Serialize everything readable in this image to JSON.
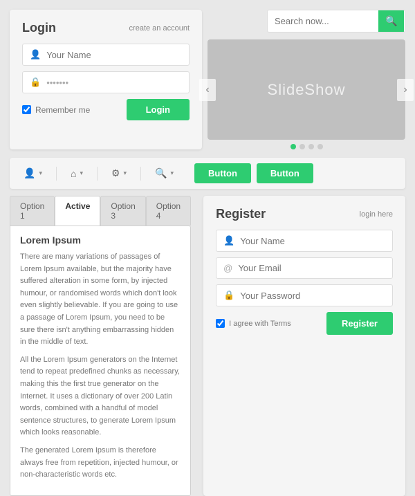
{
  "login": {
    "title": "Login",
    "create_link": "create an account",
    "name_placeholder": "Your Name",
    "password_placeholder": "●●●●●●●",
    "remember_label": "Remember me",
    "button_label": "Login"
  },
  "search": {
    "placeholder": "Search now...",
    "button_icon": "🔍"
  },
  "slideshow": {
    "label": "SlideShow",
    "dots": [
      true,
      false,
      false,
      false
    ],
    "arrow_left": "‹",
    "arrow_right": "›"
  },
  "navbar": {
    "items": [
      {
        "icon": "👤",
        "arrow": "▾"
      },
      {
        "icon": "🏠",
        "arrow": "▾"
      },
      {
        "icon": "⚙",
        "arrow": "▾"
      },
      {
        "icon": "🔍",
        "arrow": "▾"
      }
    ],
    "button1": "Button",
    "button2": "Button"
  },
  "tabs": {
    "items": [
      {
        "label": "Option 1",
        "active": false
      },
      {
        "label": "Active",
        "active": true
      },
      {
        "label": "Option 3",
        "active": false
      },
      {
        "label": "Option 4",
        "active": false
      }
    ],
    "content_title": "Lorem Ipsum",
    "paragraphs": [
      "There are many variations of passages of Lorem Ipsum available, but the majority have suffered alteration in some form, by injected humour, or randomised words which don't look even slightly believable. If you are going to use a passage of Lorem Ipsum, you need to be sure there isn't anything embarrassing hidden in the middle of text.",
      "All the Lorem Ipsum generators on the Internet tend to repeat predefined chunks as necessary, making this the first true generator on the Internet. It uses a dictionary of over 200 Latin words, combined with a handful of model sentence structures, to generate Lorem Ipsum which looks reasonable.",
      "The generated Lorem Ipsum is therefore always free from repetition, injected humour, or non-characteristic words etc."
    ]
  },
  "register": {
    "title": "Register",
    "login_link": "login here",
    "name_placeholder": "Your Name",
    "email_placeholder": "Your Email",
    "password_placeholder": "Your Password",
    "terms_label": "I agree with Terms",
    "button_label": "Register"
  }
}
